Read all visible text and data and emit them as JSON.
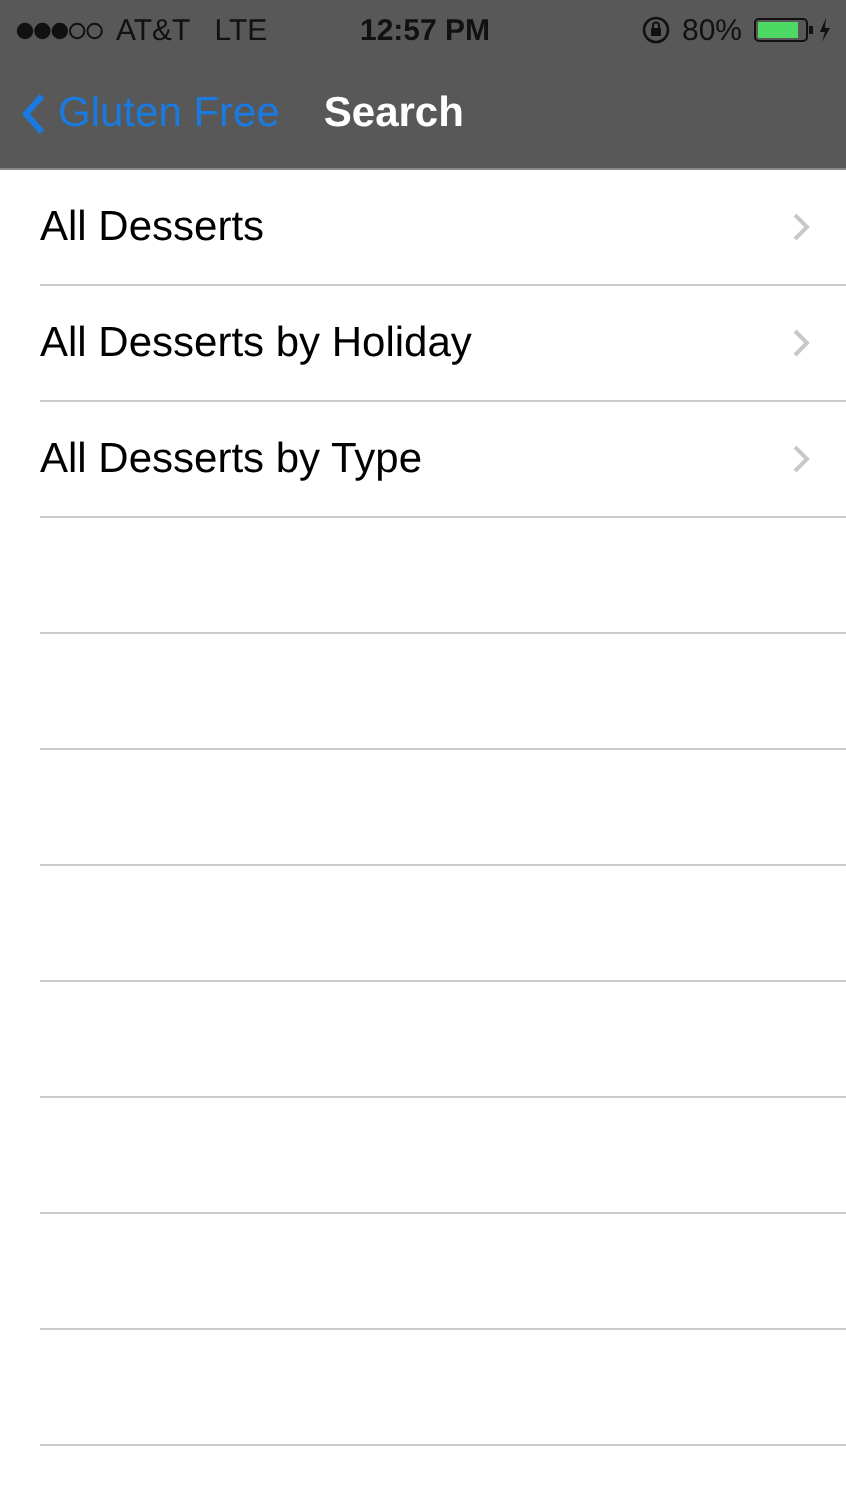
{
  "status_bar": {
    "carrier": "AT&T",
    "network": "LTE",
    "time": "12:57 PM",
    "battery": "80%"
  },
  "nav_bar": {
    "back": "Gluten Free",
    "title": "Search"
  },
  "list": [
    {
      "label": "All Desserts"
    },
    {
      "label": "All Desserts by Holiday"
    },
    {
      "label": "All Desserts by Type"
    }
  ]
}
